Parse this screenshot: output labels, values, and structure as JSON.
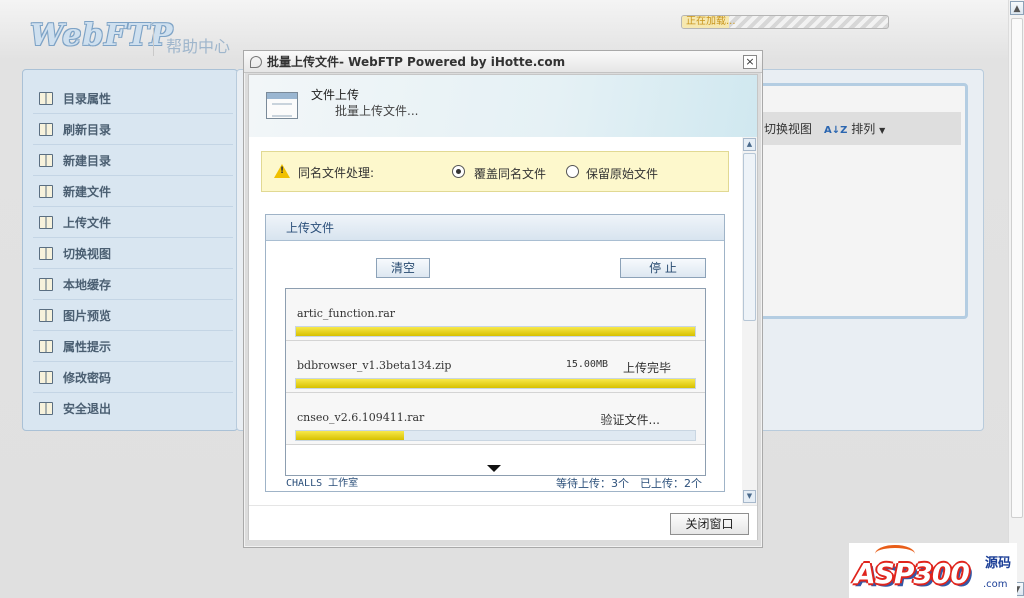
{
  "header": {
    "logo_text": "WebFTP",
    "help_center": "帮助中心",
    "loading_text": "正在加载...",
    "loading_progress": 0.23
  },
  "sidebar": {
    "items": [
      {
        "label": "目录属性"
      },
      {
        "label": "刷新目录"
      },
      {
        "label": "新建目录"
      },
      {
        "label": "新建文件"
      },
      {
        "label": "上传文件"
      },
      {
        "label": "切换视图"
      },
      {
        "label": "本地缓存"
      },
      {
        "label": "图片预览"
      },
      {
        "label": "属性提示"
      },
      {
        "label": "修改密码"
      },
      {
        "label": "安全退出"
      }
    ]
  },
  "toolbar": {
    "switch_view": "切换视图",
    "sort": "排列"
  },
  "dialog": {
    "title": "批量上传文件- WebFTP Powered by iHotte.com",
    "close_symbol": "×",
    "header_title": "文件上传",
    "header_subtitle": "批量上传文件...",
    "conflict_label": "同名文件处理:",
    "options": [
      {
        "label": "覆盖同名文件",
        "checked": true
      },
      {
        "label": "保留原始文件",
        "checked": false
      }
    ],
    "upload_panel_title": "上传文件",
    "clear_button": "清空",
    "stop_button": "停 止",
    "files": [
      {
        "name": "artic_function.rar",
        "size": "",
        "status": "",
        "progress": 1.0
      },
      {
        "name": "bdbrowser_v1.3beta134.zip",
        "size": "15.00MB",
        "status": "上传完毕",
        "progress": 1.0
      },
      {
        "name": "cnseo_v2.6.109411.rar",
        "size": "",
        "status": "验证文件...",
        "progress": 0.27
      }
    ],
    "footer_left": "CHALLS 工作室",
    "footer_right": "等待上传：3个　已上传：2个",
    "close_window_button": "关闭窗口"
  },
  "watermark": {
    "main": "ASP300",
    "sub": "源码",
    "domain": ".com"
  },
  "colors": {
    "progress_fill": "#e6d21a",
    "sidebar_bg": "#d9e6f1",
    "warning_bg": "#fdf8cc"
  }
}
